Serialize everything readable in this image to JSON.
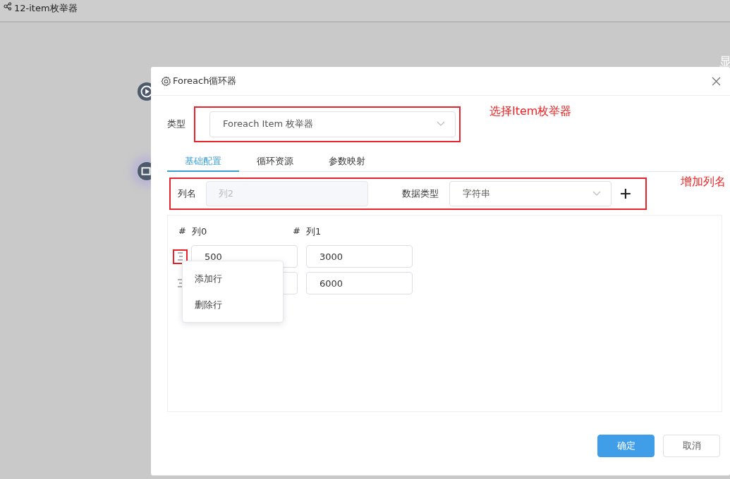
{
  "app_header": {
    "title": "12-item枚举器"
  },
  "edge_text": "显",
  "dialog": {
    "title": "Foreach循环器",
    "type_field": {
      "label": "类型",
      "value": "Foreach Item 枚举器",
      "highlighted": true
    },
    "tabs": [
      {
        "label": "基础配置",
        "selected": true
      },
      {
        "label": "循环资源",
        "selected": false
      },
      {
        "label": "参数映射",
        "selected": false
      }
    ],
    "column_form": {
      "name_label": "列名",
      "name_placeholder": "列2",
      "type_label": "数据类型",
      "type_value": "字符串",
      "highlighted": true
    },
    "table": {
      "columns": [
        {
          "mark": "#",
          "name": "列0"
        },
        {
          "mark": "#",
          "name": "列1"
        }
      ],
      "rows": [
        {
          "handle_highlighted": true,
          "col0": "500",
          "col1": "3000"
        },
        {
          "handle_highlighted": false,
          "col1": "6000"
        }
      ]
    },
    "context_menu": {
      "items": [
        "添加行",
        "删除行"
      ]
    },
    "buttons": [
      {
        "label": "确定",
        "kind": "primary"
      },
      {
        "label": "取消",
        "kind": "default"
      }
    ]
  },
  "annotations": [
    {
      "text": "选择Item枚举器"
    },
    {
      "text": "增加列名"
    }
  ]
}
